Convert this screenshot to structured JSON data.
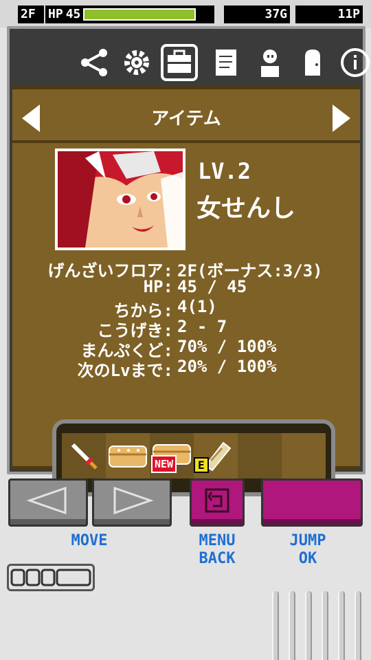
{
  "status": {
    "floor": "2F",
    "hp_label": "HP",
    "hp_value": "45",
    "hp_fill_ratio": 1.0,
    "gold": "37G",
    "points": "11P"
  },
  "menu": {
    "icons": [
      "share-icon",
      "gear-icon",
      "bag-icon",
      "notebook-icon",
      "character-icon",
      "door-icon",
      "info-icon"
    ],
    "selected": "bag-icon",
    "title": "アイテム"
  },
  "character": {
    "level": "LV.2",
    "class": "女せんし"
  },
  "stats": [
    {
      "label": "げんざいフロア:",
      "value": "2F(ボーナス:3/3)"
    },
    {
      "label": "HP:",
      "value": "45 / 45"
    },
    {
      "label": "ちから:",
      "value": "4(1)"
    },
    {
      "label": "こうげき:",
      "value": "2 - 7"
    },
    {
      "label": "まんぷくど:",
      "value": "70% / 100%"
    },
    {
      "label": "次のLvまで:",
      "value": "20% / 100%"
    }
  ],
  "inventory": {
    "new_badge": "NEW",
    "equipped_badge": "E"
  },
  "controls": {
    "move_label": "MOVE",
    "menu_label_1": "MENU",
    "menu_label_2": "BACK",
    "jump_label_1": "JUMP",
    "jump_label_2": "OK"
  },
  "colors": {
    "accent": "#b0177c",
    "caption": "#1f6fd2",
    "hp_bar": "#8fbf2a",
    "panel": "#7e6126"
  }
}
